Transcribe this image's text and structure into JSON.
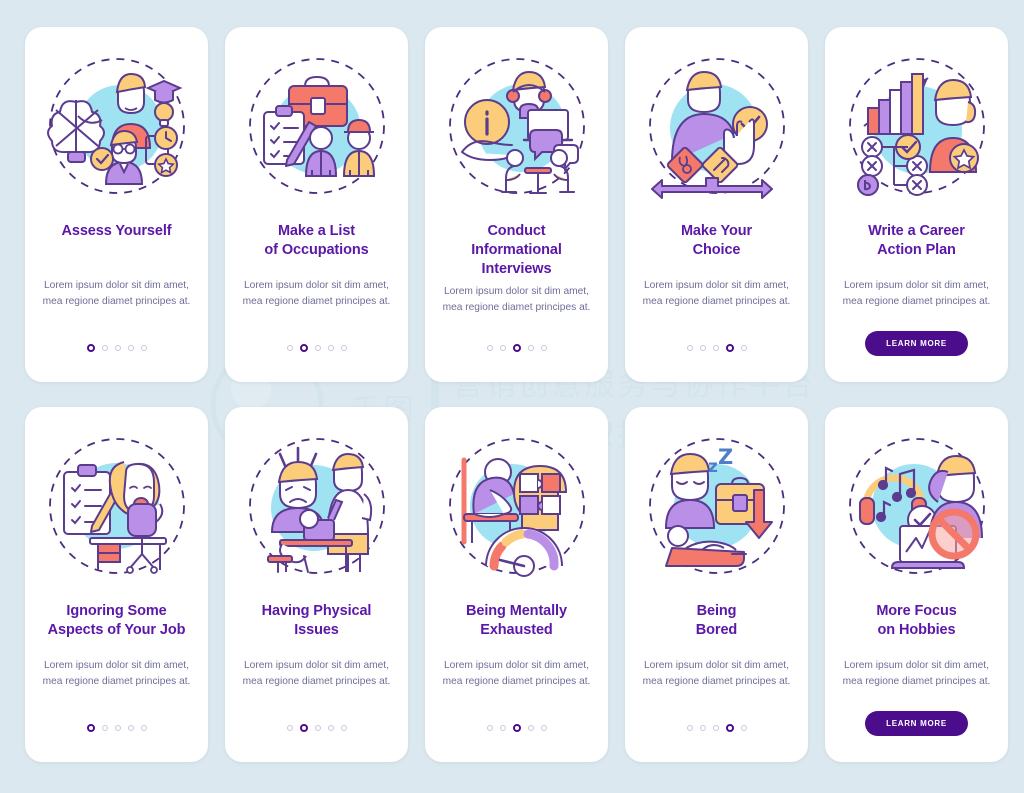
{
  "page": {
    "background_color": "#dbe8ef",
    "card_background": "#ffffff",
    "title_color": "#5b17a8",
    "body_color": "#6e6e96",
    "accent_color": "#4b0d8c",
    "dot_inactive_color": "#c9c6dd"
  },
  "watermark": {
    "brand": "千图",
    "tagline_1": "营销创意服务与协作平台",
    "tagline_2": "商用请获取授权",
    "color": "#cfe1ea"
  },
  "shared": {
    "body_text": "Lorem ipsum dolor sit dim amet, mea regione diamet principes at.",
    "learn_more_label": "LEARN MORE"
  },
  "cards": [
    {
      "title_lines": [
        "Assess Yourself"
      ],
      "body": "Lorem ipsum dolor sit dim amet, mea regione diamet principes at.",
      "dots_total": 5,
      "active_dot": 1,
      "has_button": false,
      "illustration": "self-assessment-brain-graduate-icon"
    },
    {
      "title_lines": [
        "Make a List",
        "of Occupations"
      ],
      "body": "Lorem ipsum dolor sit dim amet, mea regione diamet principes at.",
      "dots_total": 5,
      "active_dot": 2,
      "has_button": false,
      "illustration": "briefcase-checklist-workers-icon"
    },
    {
      "title_lines": [
        "Conduct",
        "Informational",
        "Interviews"
      ],
      "body": "Lorem ipsum dolor sit dim amet, mea regione diamet principes at.",
      "dots_total": 5,
      "active_dot": 3,
      "has_button": false,
      "illustration": "info-hand-interview-chat-icon"
    },
    {
      "title_lines": [
        "Make Your",
        "Choice"
      ],
      "body": "Lorem ipsum dolor sit dim amet, mea regione diamet principes at.",
      "dots_total": 5,
      "active_dot": 4,
      "has_button": false,
      "illustration": "career-signs-pointing-hand-icon"
    },
    {
      "title_lines": [
        "Write a Career",
        "Action Plan"
      ],
      "body": "Lorem ipsum dolor sit dim amet, mea regione diamet principes at.",
      "dots_total": 5,
      "active_dot": 5,
      "has_button": true,
      "button_label": "LEARN MORE",
      "illustration": "bar-chart-plan-flow-person-icon"
    },
    {
      "title_lines": [
        "Ignoring Some",
        "Aspects of Your Job"
      ],
      "body": "Lorem ipsum dolor sit dim amet, mea regione diamet principes at.",
      "dots_total": 5,
      "active_dot": 1,
      "has_button": false,
      "illustration": "yawning-person-clipboard-desk-icon"
    },
    {
      "title_lines": [
        "Having Physical",
        "Issues"
      ],
      "body": "Lorem ipsum dolor sit dim amet, mea regione diamet principes at.",
      "dots_total": 5,
      "active_dot": 2,
      "has_button": false,
      "illustration": "headache-back-pain-desk-icon"
    },
    {
      "title_lines": [
        "Being Mentally",
        "Exhausted"
      ],
      "body": "Lorem ipsum dolor sit dim amet, mea regione diamet principes at.",
      "dots_total": 5,
      "active_dot": 3,
      "has_button": false,
      "illustration": "burnout-head-puzzle-gauge-icon"
    },
    {
      "title_lines": [
        "Being",
        "Bored"
      ],
      "body": "Lorem ipsum dolor sit dim amet, mea regione diamet principes at.",
      "dots_total": 5,
      "active_dot": 4,
      "has_button": false,
      "illustration": "sleepy-person-briefcase-arrow-down-icon"
    },
    {
      "title_lines": [
        "More Focus",
        "on Hobbies"
      ],
      "body": "Lorem ipsum dolor sit dim amet, mea regione diamet principes at.",
      "dots_total": 5,
      "active_dot": 5,
      "has_button": true,
      "button_label": "LEARN MORE",
      "illustration": "headphones-music-no-laptop-icon"
    }
  ]
}
